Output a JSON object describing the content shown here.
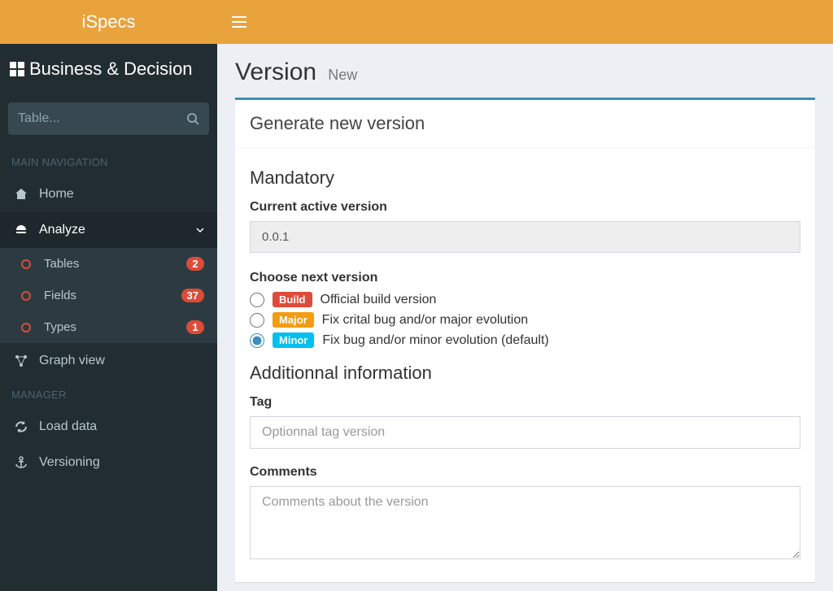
{
  "app": {
    "name_prefix": "i",
    "name_bold": "Specs"
  },
  "brand": "Business & Decision",
  "search": {
    "placeholder": "Table..."
  },
  "nav": {
    "main_header": "MAIN NAVIGATION",
    "home": "Home",
    "analyze": "Analyze",
    "tables": {
      "label": "Tables",
      "count": "2"
    },
    "fields": {
      "label": "Fields",
      "count": "37"
    },
    "types": {
      "label": "Types",
      "count": "1"
    },
    "graph": "Graph view",
    "manager_header": "MANAGER",
    "load": "Load data",
    "versioning": "Versioning"
  },
  "page": {
    "title": "Version",
    "subtitle": "New"
  },
  "panel": {
    "title": "Generate new version",
    "mandatory": "Mandatory",
    "current_label": "Current active version",
    "current_value": "0.0.1",
    "choose_label": "Choose next version",
    "options": {
      "build": {
        "pill": "Build",
        "text": "Official build version"
      },
      "major": {
        "pill": "Major",
        "text": "Fix crital bug and/or major evolution"
      },
      "minor": {
        "pill": "Minor",
        "text": "Fix bug and/or minor evolution (default)"
      }
    },
    "additional": "Additionnal information",
    "tag_label": "Tag",
    "tag_placeholder": "Optionnal tag version",
    "comments_label": "Comments",
    "comments_placeholder": "Comments about the version"
  }
}
